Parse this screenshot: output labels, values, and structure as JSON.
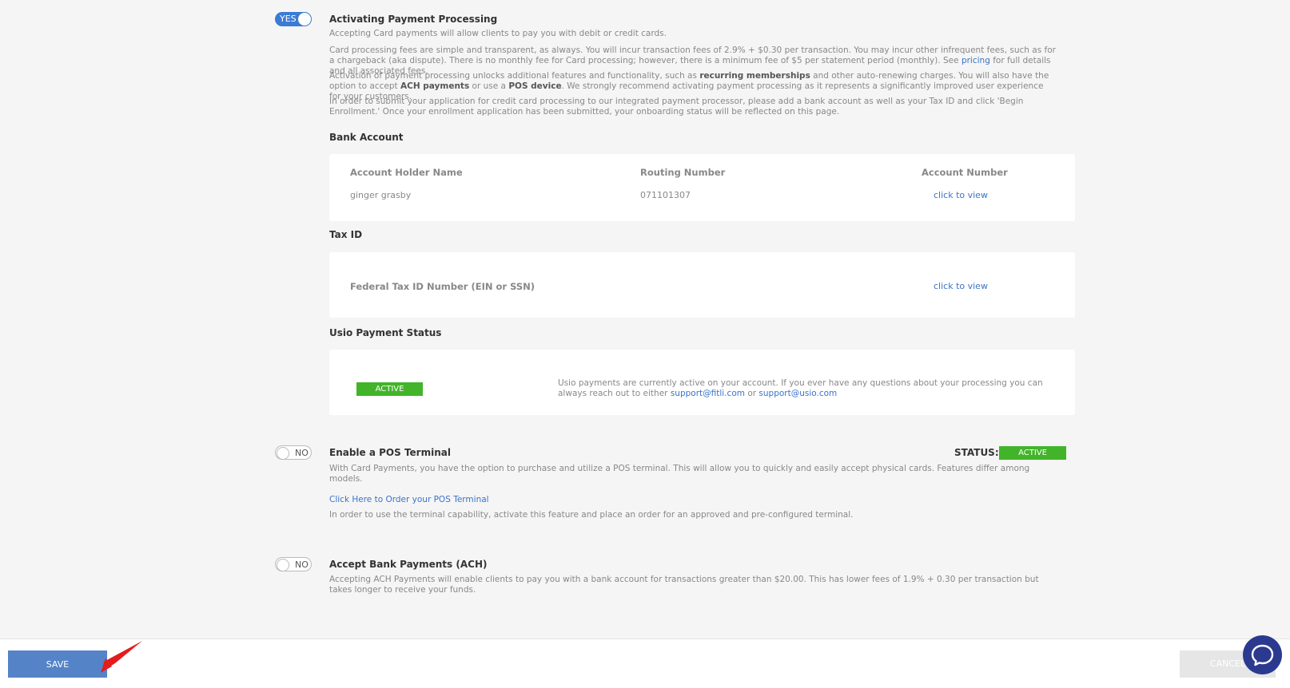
{
  "payment_processing": {
    "toggle": "YES",
    "title": "Activating Payment Processing",
    "p1": "Accepting Card payments will allow clients to pay you with debit or credit cards.",
    "p2_before": "Card processing fees are simple and transparent, as always. You will incur transaction fees of 2.9% + $0.30 per transaction. You may incur other infrequent fees, such as for a chargeback (aka dispute). There is no monthly fee for Card processing; however, there is a minimum fee of $5 per statement period (monthly). See ",
    "p2_link": "pricing",
    "p2_after": " for full details and all associated fees.",
    "p3_a": "Activation of payment processing unlocks additional features and functionality, such as ",
    "p3_b": "recurring memberships",
    "p3_c": " and other auto-renewing charges. You will also have the option to accept ",
    "p3_d": "ACH payments",
    "p3_e": " or use a ",
    "p3_f": "POS device",
    "p3_g": ". We strongly recommend activating payment processing as it represents a significantly improved user experience for your customers.",
    "p4": "In order to submit your application for credit card processing to our integrated payment processor, please add a bank account as well as your Tax ID and click 'Begin Enrollment.' Once your enrollment application has been submitted, your onboarding status will be reflected on this page."
  },
  "bank_account": {
    "heading": "Bank Account",
    "col_holder": "Account Holder Name",
    "col_routing": "Routing Number",
    "col_account": "Account Number",
    "holder": "ginger grasby",
    "routing": "071101307",
    "account_link": "click to view"
  },
  "tax_id": {
    "heading": "Tax ID",
    "label": "Federal Tax ID Number (EIN or SSN)",
    "link": "click to view"
  },
  "usio_status": {
    "heading": "Usio Payment Status",
    "badge": "ACTIVE",
    "text": "Usio payments are currently active on your account. If you ever have any questions about your processing you can always reach out to either ",
    "email1": "support@fitli.com",
    "or": " or ",
    "email2": "support@usio.com"
  },
  "pos_terminal": {
    "toggle": "NO",
    "title": "Enable a POS Terminal",
    "status_label": "STATUS:",
    "status_badge": "ACTIVE",
    "desc": "With Card Payments, you have the option to purchase and utilize a POS terminal. This will allow you to quickly and easily accept physical cards. Features differ among models.",
    "order_link": "Click Here to Order your POS Terminal",
    "note": "In order to use the terminal capability, activate this feature and place an order for an approved and pre-configured terminal."
  },
  "ach": {
    "toggle": "NO",
    "title": "Accept Bank Payments (ACH)",
    "desc": "Accepting ACH Payments will enable clients to pay you with a bank account for transactions greater than $20.00. This has lower fees of 1.9% + 0.30 per transaction but takes longer to receive your funds."
  },
  "footer": {
    "save": "SAVE",
    "cancel": "CANCEL"
  },
  "colors": {
    "accent": "#3b7bd4",
    "active_green": "#42b42a",
    "link": "#3b73c9"
  }
}
